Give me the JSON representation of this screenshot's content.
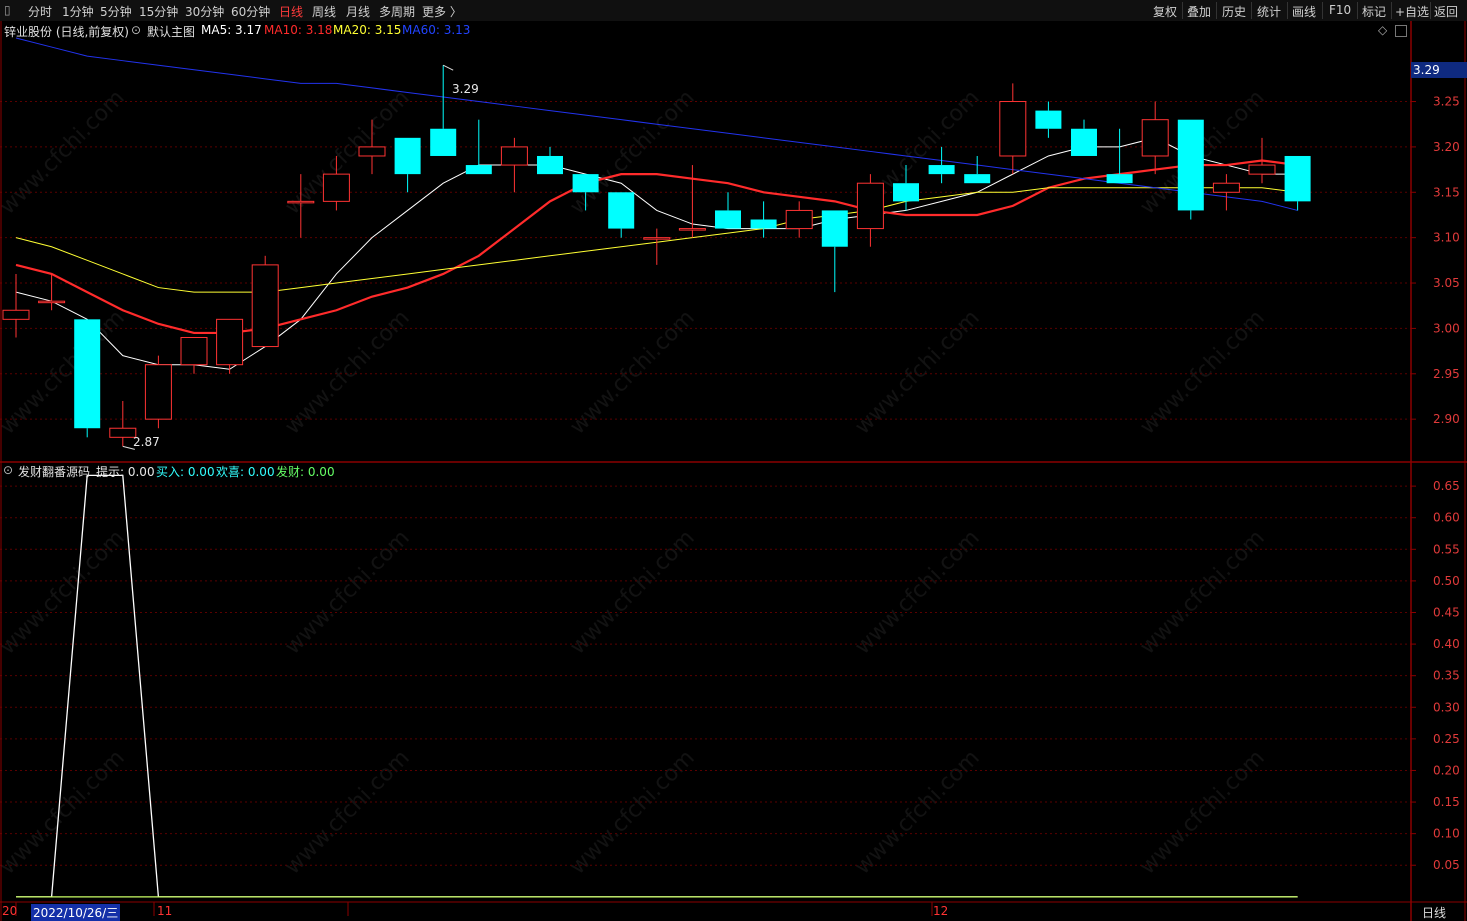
{
  "toolbar": {
    "corner_icon": "▯",
    "periods": [
      "分时",
      "1分钟",
      "5分钟",
      "15分钟",
      "30分钟",
      "60分钟",
      "日线",
      "周线",
      "月线",
      "多周期",
      "更多 〉"
    ],
    "active_period": "日线",
    "right_buttons": [
      "复权",
      "叠加",
      "历史",
      "统计",
      "画线",
      "F10",
      "标记",
      "+自选",
      "返回"
    ]
  },
  "main_panel": {
    "stock": "锌业股份 (日线,前复权)",
    "template_label": "默认主图",
    "ma_labels": [
      {
        "text": "MA5: 3.17",
        "color": "#ffffff"
      },
      {
        "text": "MA10: 3.18",
        "color": "#ff2b2b"
      },
      {
        "text": "MA20: 3.15",
        "color": "#ffff33"
      },
      {
        "text": "MA60: 3.13",
        "color": "#2244ff"
      }
    ],
    "price_tag": "3.29",
    "high_marker": "3.29",
    "low_marker": "2.87",
    "diamond_icon": "◇"
  },
  "indicator_panel": {
    "name": "发财翻番源码",
    "labels": [
      {
        "text": "提示: 0.00",
        "color": "#e8e8e8"
      },
      {
        "text": "买入: 0.00",
        "color": "#33ffff"
      },
      {
        "text": "欢喜: 0.00",
        "color": "#33ffff"
      },
      {
        "text": "发财: 0.00",
        "color": "#66ff66"
      }
    ]
  },
  "watermark": "www.cfchi.com",
  "bottom_axis": {
    "year_fragment": "20",
    "cursor_date": "2022/10/26/三",
    "month_ticks": [
      "11",
      "12"
    ],
    "period_label": "日线"
  },
  "colors": {
    "up": "#ff3333",
    "down": "#00ffff",
    "bg": "#000000",
    "grid": "#5a0000",
    "axis": "#8b0000"
  },
  "chart_data": [
    {
      "type": "candlestick",
      "title": "锌业股份 (日线,前复权)",
      "ylim": [
        2.855,
        3.32
      ],
      "yticks": [
        2.9,
        2.95,
        3.0,
        3.05,
        3.1,
        3.15,
        3.2,
        3.25
      ],
      "candles": [
        {
          "o": 3.01,
          "h": 3.06,
          "l": 2.99,
          "c": 3.02
        },
        {
          "o": 3.03,
          "h": 3.06,
          "l": 3.02,
          "c": 3.03
        },
        {
          "o": 3.01,
          "h": 3.01,
          "l": 2.88,
          "c": 2.89
        },
        {
          "o": 2.88,
          "h": 2.92,
          "l": 2.87,
          "c": 2.89
        },
        {
          "o": 2.9,
          "h": 2.97,
          "l": 2.89,
          "c": 2.96
        },
        {
          "o": 2.96,
          "h": 2.99,
          "l": 2.95,
          "c": 2.99
        },
        {
          "o": 2.96,
          "h": 3.01,
          "l": 2.95,
          "c": 3.01
        },
        {
          "o": 2.98,
          "h": 3.08,
          "l": 2.98,
          "c": 3.07
        },
        {
          "o": 3.14,
          "h": 3.17,
          "l": 3.1,
          "c": 3.14
        },
        {
          "o": 3.14,
          "h": 3.19,
          "l": 3.13,
          "c": 3.17
        },
        {
          "o": 3.19,
          "h": 3.23,
          "l": 3.17,
          "c": 3.2
        },
        {
          "o": 3.21,
          "h": 3.21,
          "l": 3.15,
          "c": 3.17
        },
        {
          "o": 3.22,
          "h": 3.29,
          "l": 3.19,
          "c": 3.19
        },
        {
          "o": 3.18,
          "h": 3.23,
          "l": 3.17,
          "c": 3.17
        },
        {
          "o": 3.18,
          "h": 3.21,
          "l": 3.15,
          "c": 3.2
        },
        {
          "o": 3.19,
          "h": 3.2,
          "l": 3.17,
          "c": 3.17
        },
        {
          "o": 3.17,
          "h": 3.17,
          "l": 3.13,
          "c": 3.15
        },
        {
          "o": 3.15,
          "h": 3.15,
          "l": 3.1,
          "c": 3.11
        },
        {
          "o": 3.1,
          "h": 3.11,
          "l": 3.07,
          "c": 3.1
        },
        {
          "o": 3.11,
          "h": 3.18,
          "l": 3.1,
          "c": 3.11
        },
        {
          "o": 3.13,
          "h": 3.15,
          "l": 3.11,
          "c": 3.11
        },
        {
          "o": 3.12,
          "h": 3.14,
          "l": 3.1,
          "c": 3.11
        },
        {
          "o": 3.11,
          "h": 3.14,
          "l": 3.1,
          "c": 3.13
        },
        {
          "o": 3.13,
          "h": 3.13,
          "l": 3.04,
          "c": 3.09
        },
        {
          "o": 3.11,
          "h": 3.17,
          "l": 3.09,
          "c": 3.16
        },
        {
          "o": 3.16,
          "h": 3.18,
          "l": 3.13,
          "c": 3.14
        },
        {
          "o": 3.18,
          "h": 3.2,
          "l": 3.16,
          "c": 3.17
        },
        {
          "o": 3.17,
          "h": 3.19,
          "l": 3.16,
          "c": 3.16
        },
        {
          "o": 3.19,
          "h": 3.27,
          "l": 3.17,
          "c": 3.25
        },
        {
          "o": 3.24,
          "h": 3.25,
          "l": 3.21,
          "c": 3.22
        },
        {
          "o": 3.22,
          "h": 3.23,
          "l": 3.19,
          "c": 3.19
        },
        {
          "o": 3.17,
          "h": 3.22,
          "l": 3.16,
          "c": 3.16
        },
        {
          "o": 3.19,
          "h": 3.25,
          "l": 3.17,
          "c": 3.23
        },
        {
          "o": 3.23,
          "h": 3.23,
          "l": 3.12,
          "c": 3.13
        },
        {
          "o": 3.15,
          "h": 3.17,
          "l": 3.13,
          "c": 3.16
        },
        {
          "o": 3.17,
          "h": 3.21,
          "l": 3.16,
          "c": 3.18
        },
        {
          "o": 3.19,
          "h": 3.19,
          "l": 3.13,
          "c": 3.14
        }
      ],
      "ma": [
        {
          "name": "MA5",
          "color": "#ffffff",
          "values": [
            3.04,
            3.03,
            3.01,
            2.97,
            2.96,
            2.96,
            2.955,
            2.98,
            3.01,
            3.06,
            3.1,
            3.13,
            3.16,
            3.18,
            3.18,
            3.18,
            3.17,
            3.16,
            3.13,
            3.115,
            3.11,
            3.11,
            3.11,
            3.12,
            3.125,
            3.13,
            3.14,
            3.15,
            3.17,
            3.19,
            3.2,
            3.2,
            3.21,
            3.19,
            3.18,
            3.17,
            3.17
          ]
        },
        {
          "name": "MA10",
          "color": "#ff2b2b",
          "values": [
            3.07,
            3.06,
            3.04,
            3.02,
            3.005,
            2.995,
            2.995,
            3.0,
            3.01,
            3.02,
            3.035,
            3.045,
            3.06,
            3.08,
            3.11,
            3.14,
            3.16,
            3.17,
            3.17,
            3.165,
            3.16,
            3.15,
            3.145,
            3.14,
            3.13,
            3.125,
            3.125,
            3.125,
            3.135,
            3.155,
            3.165,
            3.17,
            3.175,
            3.18,
            3.18,
            3.185,
            3.18
          ]
        },
        {
          "name": "MA20",
          "color": "#ffff33",
          "values": [
            3.1,
            3.09,
            3.075,
            3.06,
            3.045,
            3.04,
            3.04,
            3.04,
            3.045,
            3.05,
            3.055,
            3.06,
            3.065,
            3.07,
            3.075,
            3.08,
            3.085,
            3.09,
            3.095,
            3.1,
            3.105,
            3.11,
            3.12,
            3.125,
            3.13,
            3.14,
            3.145,
            3.15,
            3.15,
            3.155,
            3.155,
            3.155,
            3.155,
            3.155,
            3.155,
            3.155,
            3.15
          ]
        },
        {
          "name": "MA60",
          "color": "#2233ee",
          "values": [
            3.32,
            3.31,
            3.3,
            3.295,
            3.29,
            3.285,
            3.28,
            3.275,
            3.27,
            3.27,
            3.265,
            3.26,
            3.255,
            3.25,
            3.245,
            3.24,
            3.235,
            3.23,
            3.225,
            3.22,
            3.215,
            3.21,
            3.205,
            3.2,
            3.195,
            3.19,
            3.185,
            3.18,
            3.175,
            3.17,
            3.165,
            3.16,
            3.155,
            3.15,
            3.145,
            3.14,
            3.13
          ]
        }
      ]
    },
    {
      "type": "line",
      "title": "发财翻番源码",
      "ylim": [
        -0.005,
        0.685
      ],
      "yticks": [
        0.05,
        0.1,
        0.15,
        0.2,
        0.25,
        0.3,
        0.35,
        0.4,
        0.45,
        0.5,
        0.55,
        0.6,
        0.65
      ],
      "series": [
        {
          "name": "提示",
          "color": "#ffffff",
          "values": [
            0,
            0,
            0.667,
            0.667,
            0,
            0,
            0,
            0,
            0,
            0,
            0,
            0,
            0,
            0,
            0,
            0,
            0,
            0,
            0,
            0,
            0,
            0,
            0,
            0,
            0,
            0,
            0,
            0,
            0,
            0,
            0,
            0,
            0,
            0,
            0,
            0,
            0
          ]
        },
        {
          "name": "发财",
          "color": "#ccff66",
          "values": [
            0,
            0,
            0,
            0,
            0,
            0,
            0,
            0,
            0,
            0,
            0,
            0,
            0,
            0,
            0,
            0,
            0,
            0,
            0,
            0,
            0,
            0,
            0,
            0,
            0,
            0,
            0,
            0,
            0,
            0,
            0,
            0,
            0,
            0,
            0,
            0,
            0
          ]
        }
      ]
    }
  ]
}
